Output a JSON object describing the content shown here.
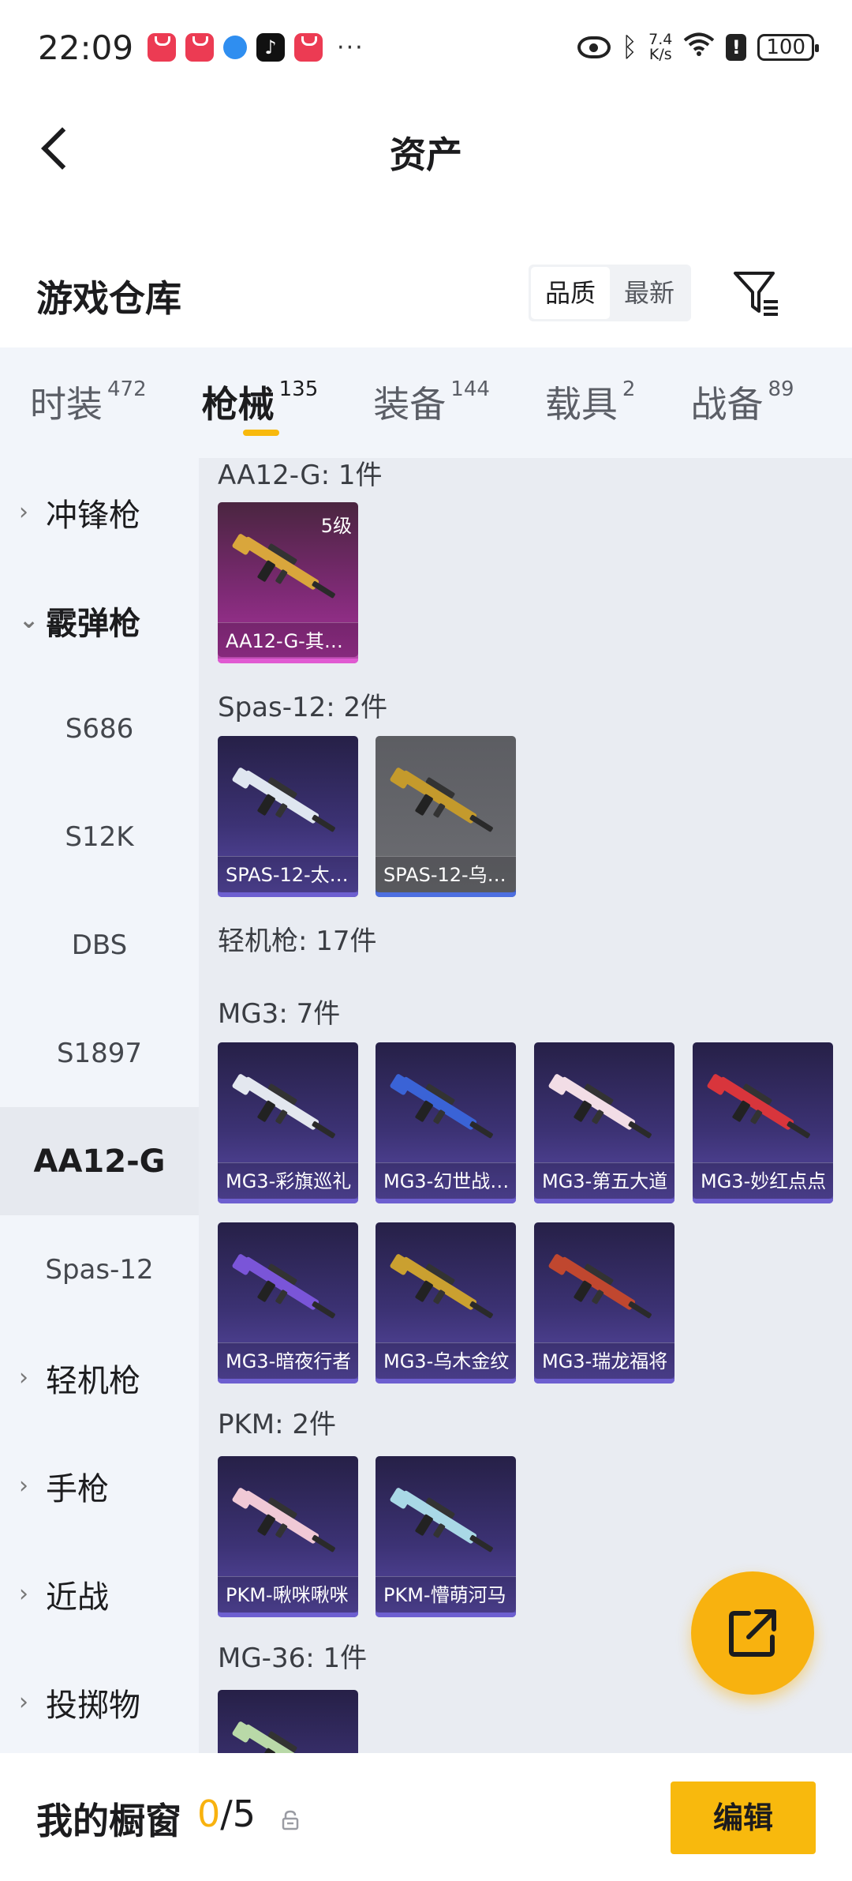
{
  "status_bar": {
    "time": "22:09",
    "more": "···",
    "speed_value": "7.4",
    "speed_unit": "K/s",
    "battery": "100"
  },
  "nav": {
    "title": "资产"
  },
  "header": {
    "title": "游戏仓库",
    "sort_options": [
      "品质",
      "最新"
    ],
    "sort_selected": "品质"
  },
  "tabs": [
    {
      "label": "时装",
      "count": "472"
    },
    {
      "label": "枪械",
      "count": "135",
      "active": true
    },
    {
      "label": "装备",
      "count": "144"
    },
    {
      "label": "载具",
      "count": "2"
    },
    {
      "label": "战备",
      "count": "89"
    }
  ],
  "sidebar": {
    "items": [
      {
        "type": "category",
        "label": "冲锋枪",
        "arrow": "›"
      },
      {
        "type": "category",
        "label": "霰弹枪",
        "arrow": "⌄",
        "open": true
      },
      {
        "type": "sub",
        "label": "S686"
      },
      {
        "type": "sub",
        "label": "S12K"
      },
      {
        "type": "sub",
        "label": "DBS"
      },
      {
        "type": "sub",
        "label": "S1897"
      },
      {
        "type": "sub",
        "label": "AA12-G",
        "active": true
      },
      {
        "type": "sub",
        "label": "Spas-12"
      },
      {
        "type": "category",
        "label": "轻机枪",
        "arrow": "›"
      },
      {
        "type": "category",
        "label": "手枪",
        "arrow": "›"
      },
      {
        "type": "category",
        "label": "近战",
        "arrow": "›"
      },
      {
        "type": "category",
        "label": "投掷物",
        "arrow": "›"
      }
    ]
  },
  "content": {
    "groups": [
      {
        "title": "AA12-G: 1件"
      },
      {
        "title": "Spas-12: 2件"
      },
      {
        "title": "轻机枪: 17件"
      },
      {
        "title": "MG3: 7件"
      },
      {
        "title": "PKM: 2件"
      },
      {
        "title": "MG-36: 1件"
      }
    ],
    "items": [
      {
        "name": "AA12-G-其…",
        "level": "5级",
        "rarity": "pink",
        "weapon_color": "#d9a63c"
      },
      {
        "name": "SPAS-12-太…",
        "rarity": "purple",
        "weapon_color": "#dfe6f0"
      },
      {
        "name": "SPAS-12-乌…",
        "rarity": "gray",
        "weapon_color": "#c49a2c"
      },
      {
        "name": "MG3-彩旗巡礼",
        "rarity": "purple",
        "weapon_color": "#e3e7ef"
      },
      {
        "name": "MG3-幻世战…",
        "rarity": "purple",
        "weapon_color": "#3a63d6"
      },
      {
        "name": "MG3-第五大道",
        "rarity": "purple",
        "weapon_color": "#f2dde6"
      },
      {
        "name": "MG3-妙红点点",
        "rarity": "purple",
        "weapon_color": "#d8353c"
      },
      {
        "name": "MG3-暗夜行者",
        "rarity": "purple",
        "weapon_color": "#7a55d8"
      },
      {
        "name": "MG3-乌木金纹",
        "rarity": "purple",
        "weapon_color": "#caa030"
      },
      {
        "name": "MG3-瑞龙福将",
        "rarity": "purple",
        "weapon_color": "#c0472f"
      },
      {
        "name": "PKM-啾咪啾咪",
        "rarity": "purple",
        "weapon_color": "#f0c9d6"
      },
      {
        "name": "PKM-懵萌河马",
        "rarity": "purple",
        "weapon_color": "#a9d8e6"
      },
      {
        "name": "",
        "rarity": "purple",
        "weapon_color": "#b9d9a8"
      }
    ]
  },
  "bottom_bar": {
    "label": "我的橱窗",
    "current": "0",
    "total": "/5",
    "edit_label": "编辑"
  },
  "colors": {
    "accent": "#f8b90d",
    "tab_bg": "#f2f5fa",
    "content_bg": "#e9ecf2"
  }
}
